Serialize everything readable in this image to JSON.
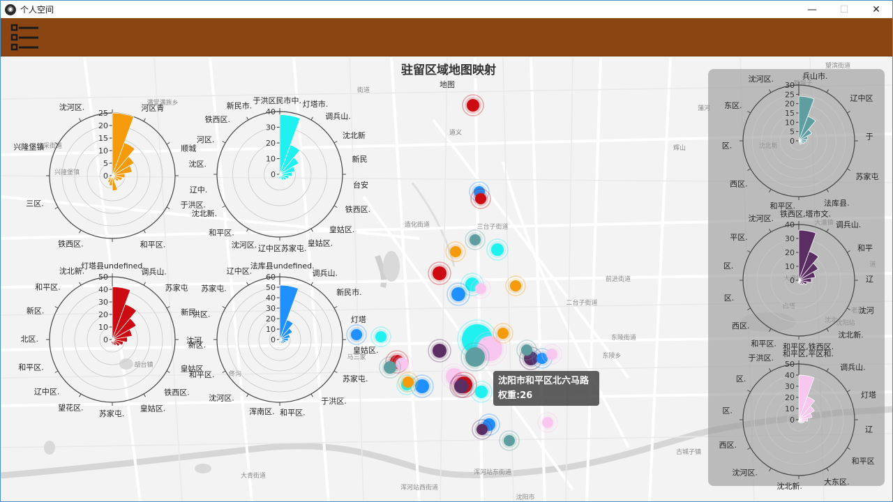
{
  "window": {
    "title": "个人空间",
    "controls": {
      "minimize": "—",
      "maximize": "☐",
      "close": "✕"
    }
  },
  "toolbar": {
    "menu_icon": "list-menu-icon"
  },
  "map": {
    "title": "驻留区域地图映射",
    "legend": "地图",
    "street_labels": [
      "道义",
      "造化街道",
      "三台子街道",
      "前进街道",
      "二台子街道",
      "东陵街道",
      "东陵乡",
      "大青街道",
      "浑河站西街道",
      "浑河站东街道",
      "沈阳市",
      "古城子镇",
      "辉山",
      "蒲河",
      "望滨街道",
      "沈北新",
      "兴隆堡镇",
      "沈采街道",
      "胡台镇",
      "新城子",
      "大潘镇",
      "大淑堡镇",
      "佟沟",
      "道义",
      "满堂满族乡",
      "沈北",
      "沈阳站",
      "马三家",
      "老边",
      "街道",
      "道",
      "白塔"
    ],
    "colors": {
      "orange": "#f59a0b",
      "cyan": "#1ff0f0",
      "red": "#cc0a12",
      "blue": "#1e90ff",
      "teal": "#5f9ea0",
      "purple": "#5b2e63",
      "pink": "#f8c6ef"
    }
  },
  "tooltip": {
    "line1": "沈阳市和平区北六马路",
    "line2": "权重:26"
  },
  "chart_data": [
    {
      "type": "polar-bar",
      "color": "orange",
      "radial_ticks": [
        "25",
        "20",
        "15",
        "10",
        "5",
        "0"
      ],
      "ylim": [
        0,
        25
      ],
      "top_label": "河区青",
      "labels": [
        "沈河区.",
        "河区青",
        "顺城",
        "于洪区.",
        "和平区.",
        "铁西区.",
        "三区.",
        "兴隆堡镇"
      ],
      "values": [
        25,
        14,
        10,
        8,
        5,
        4,
        3,
        2,
        6,
        4,
        3,
        2
      ]
    },
    {
      "type": "polar-bar",
      "color": "cyan",
      "radial_ticks": [
        "40",
        "30",
        "20",
        "10",
        "0"
      ],
      "ylim": [
        0,
        40
      ],
      "top_label": "于洪区民市中.",
      "labels": [
        "新民市.",
        "于洪区民市中.",
        "灯塔市.",
        "调兵山.",
        "沈北新",
        "新民",
        "台安",
        "铁西区.",
        "皇姑区.",
        "皇姑区.",
        "辽中区苏家屯.",
        "沈河区.",
        "和平区.",
        "沈北新.",
        "辽中.",
        "沈区.",
        "河区.",
        "铁西区."
      ],
      "values": [
        38,
        20,
        14,
        10,
        8,
        6,
        5,
        4,
        3,
        3,
        2,
        2
      ]
    },
    {
      "type": "polar-bar",
      "color": "red",
      "radial_ticks": [
        "50",
        "40",
        "30",
        "20",
        "10",
        "0"
      ],
      "ylim": [
        0,
        50
      ],
      "top_label": "灯塔县undefined.",
      "labels": [
        "沈北新.",
        "灯塔县undefined.",
        "调兵山.",
        "苏家屯",
        "新民",
        "沈河",
        "皇姑区",
        "铁西区.",
        "皇姑区.",
        "苏家屯.",
        "望花区.",
        "辽中区.",
        "和平区.",
        "北区.",
        "新区.",
        "和平区."
      ],
      "values": [
        42,
        30,
        22,
        16,
        12,
        9,
        7,
        5,
        4,
        3,
        2,
        2
      ]
    },
    {
      "type": "polar-bar",
      "color": "blue",
      "radial_ticks": [
        "60",
        "50",
        "40",
        "30",
        "20",
        "10",
        "0"
      ],
      "ylim": [
        0,
        60
      ],
      "top_label": "法库县undefined.",
      "labels": [
        "辽中区.",
        "法库县undefined.",
        "调兵山.",
        "新民市.",
        "灯塔",
        "皇姑区.",
        "苏家屯.",
        "于洪区.",
        "和平区.",
        "浑南区.",
        "沈河区.",
        "和平区.",
        "新区.",
        "洪区.",
        "苏家屯."
      ],
      "values": [
        52,
        20,
        14,
        10,
        8,
        6,
        5,
        4,
        3,
        3,
        2,
        2
      ]
    },
    {
      "type": "polar-bar",
      "color": "teal",
      "radial_ticks": [
        "30",
        "25",
        "20",
        "15",
        "10",
        "5",
        "0"
      ],
      "ylim": [
        0,
        30
      ],
      "top_label": "兵山市.",
      "labels": [
        "沈河区.",
        "兵山市.",
        "辽中区",
        "于",
        "苏家屯",
        "法库县.",
        "和平区.",
        "西区.",
        "区.",
        "东区."
      ],
      "values": [
        24,
        14,
        8,
        5,
        4,
        3,
        2,
        2
      ]
    },
    {
      "type": "polar-bar",
      "color": "purple",
      "radial_ticks": [
        "40",
        "30",
        "20",
        "10",
        "0"
      ],
      "ylim": [
        0,
        40
      ],
      "top_label": "铁西区,塔市文.",
      "labels": [
        "沈河区.",
        "铁西区,塔市文.",
        "调兵山.",
        "和平",
        "辽",
        "沈河",
        "沈北新.",
        "和平区,铁西区.",
        "和平区.",
        "西区.",
        "区.",
        "区.",
        "平区."
      ],
      "values": [
        36,
        22,
        16,
        12,
        9,
        6,
        4,
        3,
        2,
        2
      ]
    },
    {
      "type": "polar-bar",
      "color": "pink",
      "radial_ticks": [
        "50",
        "40",
        "30",
        "20",
        "10",
        "0"
      ],
      "ylim": [
        0,
        50
      ],
      "top_label": "和平区,平区和.",
      "labels": [
        "于洪区.",
        "和平区,平区和.",
        "调兵山.",
        "灯塔",
        "辽",
        "和平区",
        "大东区.",
        "沈北新.",
        "沈河区.",
        "西区.",
        "区.",
        "区."
      ],
      "values": [
        40,
        22,
        16,
        12,
        8,
        5,
        4,
        3,
        2,
        2
      ]
    }
  ]
}
